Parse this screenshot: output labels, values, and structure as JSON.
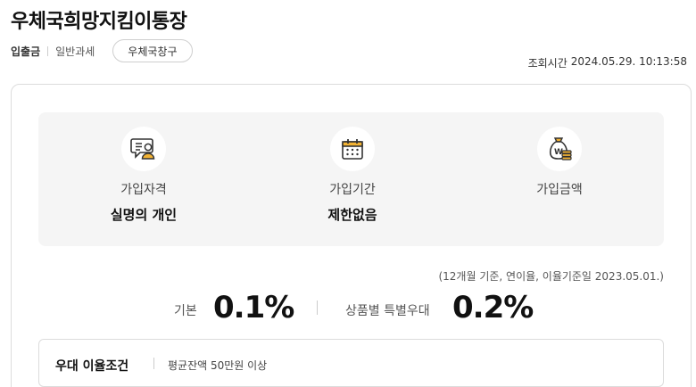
{
  "product": {
    "title": "우체국희망지킴이통장",
    "type": "입출금",
    "tax": "일반과세",
    "channel_button": "우체국창구"
  },
  "inquiry": {
    "label": "조회시간",
    "datetime": "2024.05.29. 10:13:58"
  },
  "info": [
    {
      "icon": "id-card-person-icon",
      "label": "가입자격",
      "value": "실명의 개인"
    },
    {
      "icon": "calendar-icon",
      "label": "가입기간",
      "value": "제한없음"
    },
    {
      "icon": "money-bag-coins-icon",
      "label": "가입금액",
      "value": ""
    }
  ],
  "rates": {
    "basis_note": "(12개월 기준, 연이율, 이율기준일 2023.05.01.)",
    "base_label": "기본",
    "base_value": "0.1%",
    "special_label": "상품별 특별우대",
    "special_value": "0.2%"
  },
  "condition": {
    "title": "우대 이율조건",
    "text": "평균잔액 50만원 이상"
  },
  "colors": {
    "icon_accent": "#f2b233",
    "icon_line": "#333333",
    "info_bg": "#f5f5f5"
  }
}
